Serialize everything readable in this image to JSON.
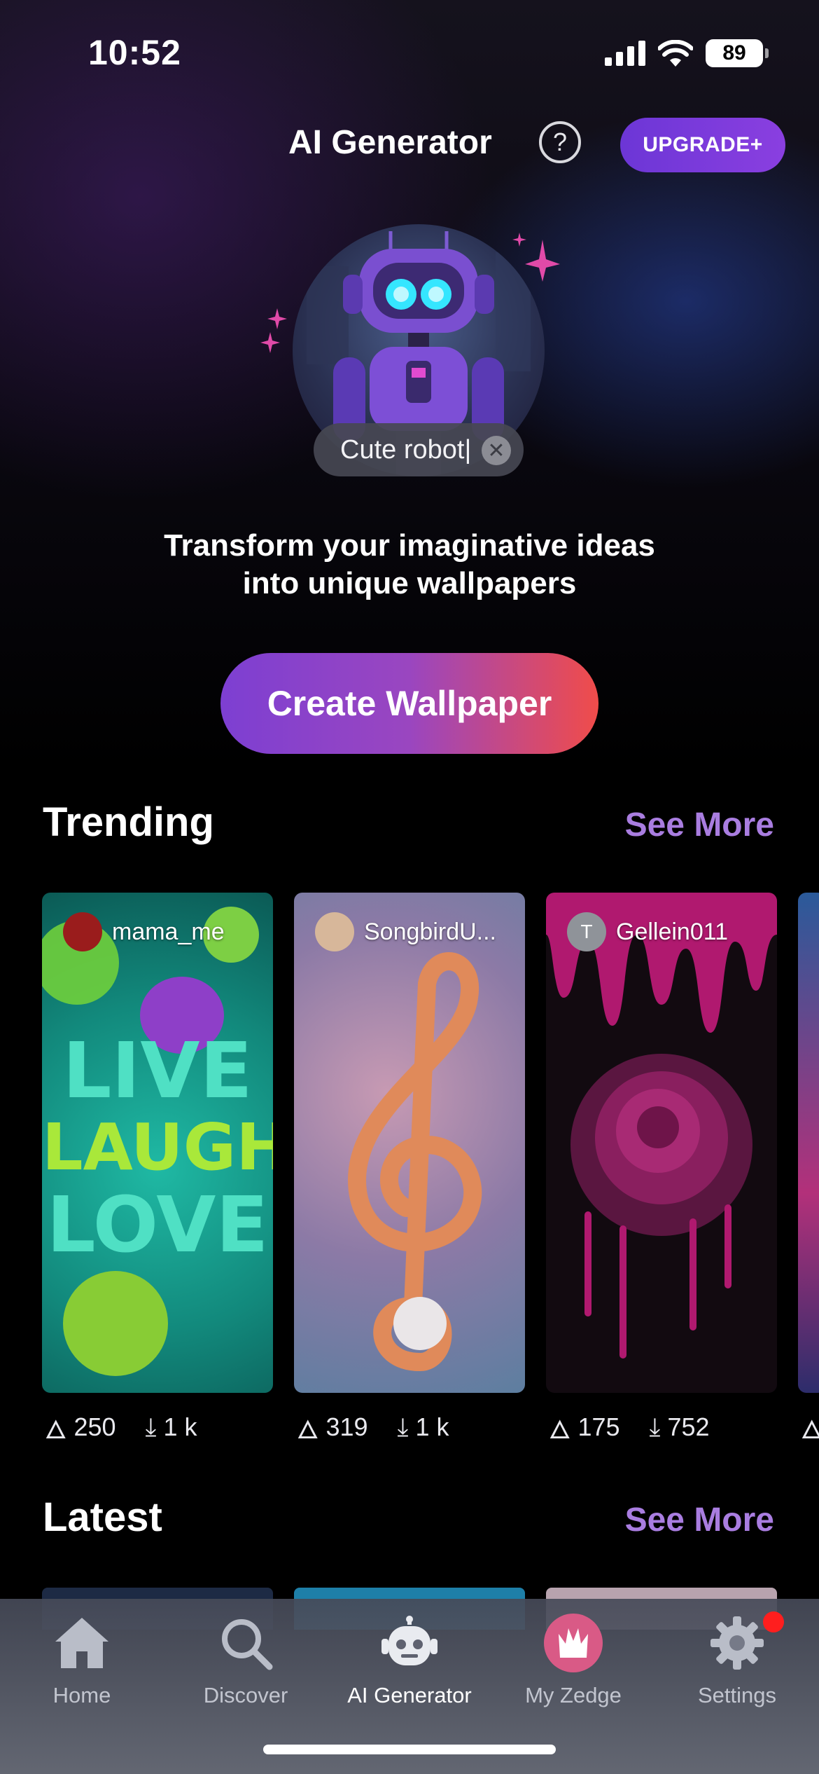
{
  "status_bar": {
    "time": "10:52",
    "battery": "89"
  },
  "header": {
    "title": "AI Generator",
    "help": "?",
    "upgrade_label": "UPGRADE+"
  },
  "hero": {
    "prompt_text": "Cute robot|",
    "tagline_line1": "Transform your imaginative ideas",
    "tagline_line2": "into unique wallpapers",
    "create_label": "Create Wallpaper"
  },
  "trending": {
    "title": "Trending",
    "see_more": "See More",
    "cards": [
      {
        "author": "mama_me",
        "likes": "250",
        "downloads": "1 k",
        "avatar_text": ""
      },
      {
        "author": "SongbirdU...",
        "likes": "319",
        "downloads": "1 k",
        "avatar_text": ""
      },
      {
        "author": "Gellein011",
        "likes": "175",
        "downloads": "752",
        "avatar_text": "T"
      }
    ]
  },
  "latest": {
    "title": "Latest",
    "see_more": "See More"
  },
  "tabbar": {
    "items": [
      {
        "label": "Home",
        "icon": "home-icon"
      },
      {
        "label": "Discover",
        "icon": "search-icon"
      },
      {
        "label": "AI Generator",
        "icon": "robot-icon"
      },
      {
        "label": "My Zedge",
        "icon": "zedge-icon"
      },
      {
        "label": "Settings",
        "icon": "gear-icon"
      }
    ],
    "active": "AI Generator"
  },
  "colors": {
    "accent": "#a97de0",
    "upgrade": "#7a3ad9",
    "badge": "#ff1e1e"
  }
}
